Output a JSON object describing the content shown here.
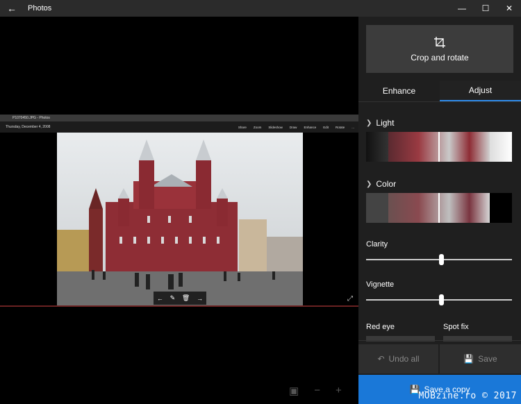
{
  "titlebar": {
    "title": "Photos",
    "back_icon": "back-arrow-icon",
    "minimize_icon": "minimize-icon",
    "maximize_icon": "maximize-icon",
    "close_icon": "close-icon"
  },
  "inner_app": {
    "window_title": "P1070450.JPG - Photos",
    "date": "Thursday, December 4, 2008",
    "actions": [
      "Share",
      "Zoom",
      "Slideshow",
      "Draw",
      "Enhance",
      "Edit",
      "Rotate",
      "..."
    ]
  },
  "panel": {
    "crop_label": "Crop and rotate",
    "tabs": [
      {
        "label": "Enhance",
        "active": false
      },
      {
        "label": "Adjust",
        "active": true
      }
    ],
    "light_label": "Light",
    "color_label": "Color",
    "clarity_label": "Clarity",
    "clarity_value": 0.5,
    "vignette_label": "Vignette",
    "vignette_value": 0.5,
    "red_eye_label": "Red eye",
    "spot_fix_label": "Spot fix",
    "undo_label": "Undo all",
    "save_label": "Save",
    "save_copy_label": "Save a copy"
  },
  "colors": {
    "accent": "#1a78d8",
    "panel_bg": "#1f1f1f",
    "titlebar_bg": "#2b2b2b"
  },
  "watermark": "MOBzine.ro © 2017"
}
